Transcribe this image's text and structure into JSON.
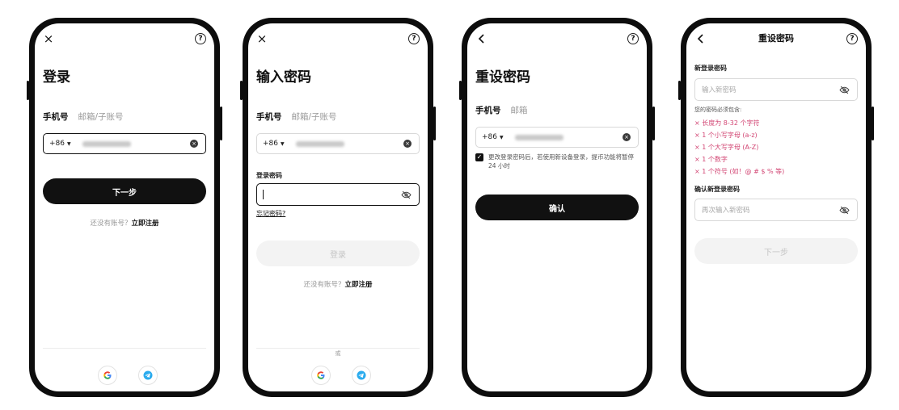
{
  "screen1": {
    "close_icon": "×",
    "help_icon": "?",
    "title": "登录",
    "tab_phone": "手机号",
    "tab_email": "邮箱/子账号",
    "country_code": "+86",
    "next_button": "下一步",
    "register_prompt": "还没有账号？",
    "register_link": "立即注册"
  },
  "screen2": {
    "close_icon": "×",
    "help_icon": "?",
    "title": "输入密码",
    "tab_phone": "手机号",
    "tab_email": "邮箱/子账号",
    "country_code": "+86",
    "password_label": "登录密码",
    "forgot_link": "忘记密码?",
    "login_button": "登录",
    "register_prompt": "还没有账号？",
    "register_link": "立即注册",
    "or_text": "或"
  },
  "screen3": {
    "help_icon": "?",
    "title": "重设密码",
    "tab_phone": "手机号",
    "tab_email": "邮箱",
    "country_code": "+86",
    "notice": "更改登录密码后，若使用新设备登录，提币功能将暂停 24 小时",
    "confirm_button": "确认"
  },
  "screen4": {
    "help_icon": "?",
    "header_title": "重设密码",
    "new_pw_label": "新登录密码",
    "new_pw_placeholder": "输入新密码",
    "requirements_heading": "您的密码必须包含:",
    "requirements": [
      "× 长度为 8-32 个字符",
      "× 1 个小写字母 (a-z)",
      "× 1 个大写字母 (A-Z)",
      "× 1 个数字",
      "× 1 个符号 (如！@ # $ % 等)"
    ],
    "confirm_pw_label": "确认新登录密码",
    "confirm_pw_placeholder": "再次输入新密码",
    "next_button": "下一步"
  },
  "colors": {
    "primary": "#111111",
    "requirement_red": "#d24573",
    "disabled_bg": "#f3f3f3"
  }
}
